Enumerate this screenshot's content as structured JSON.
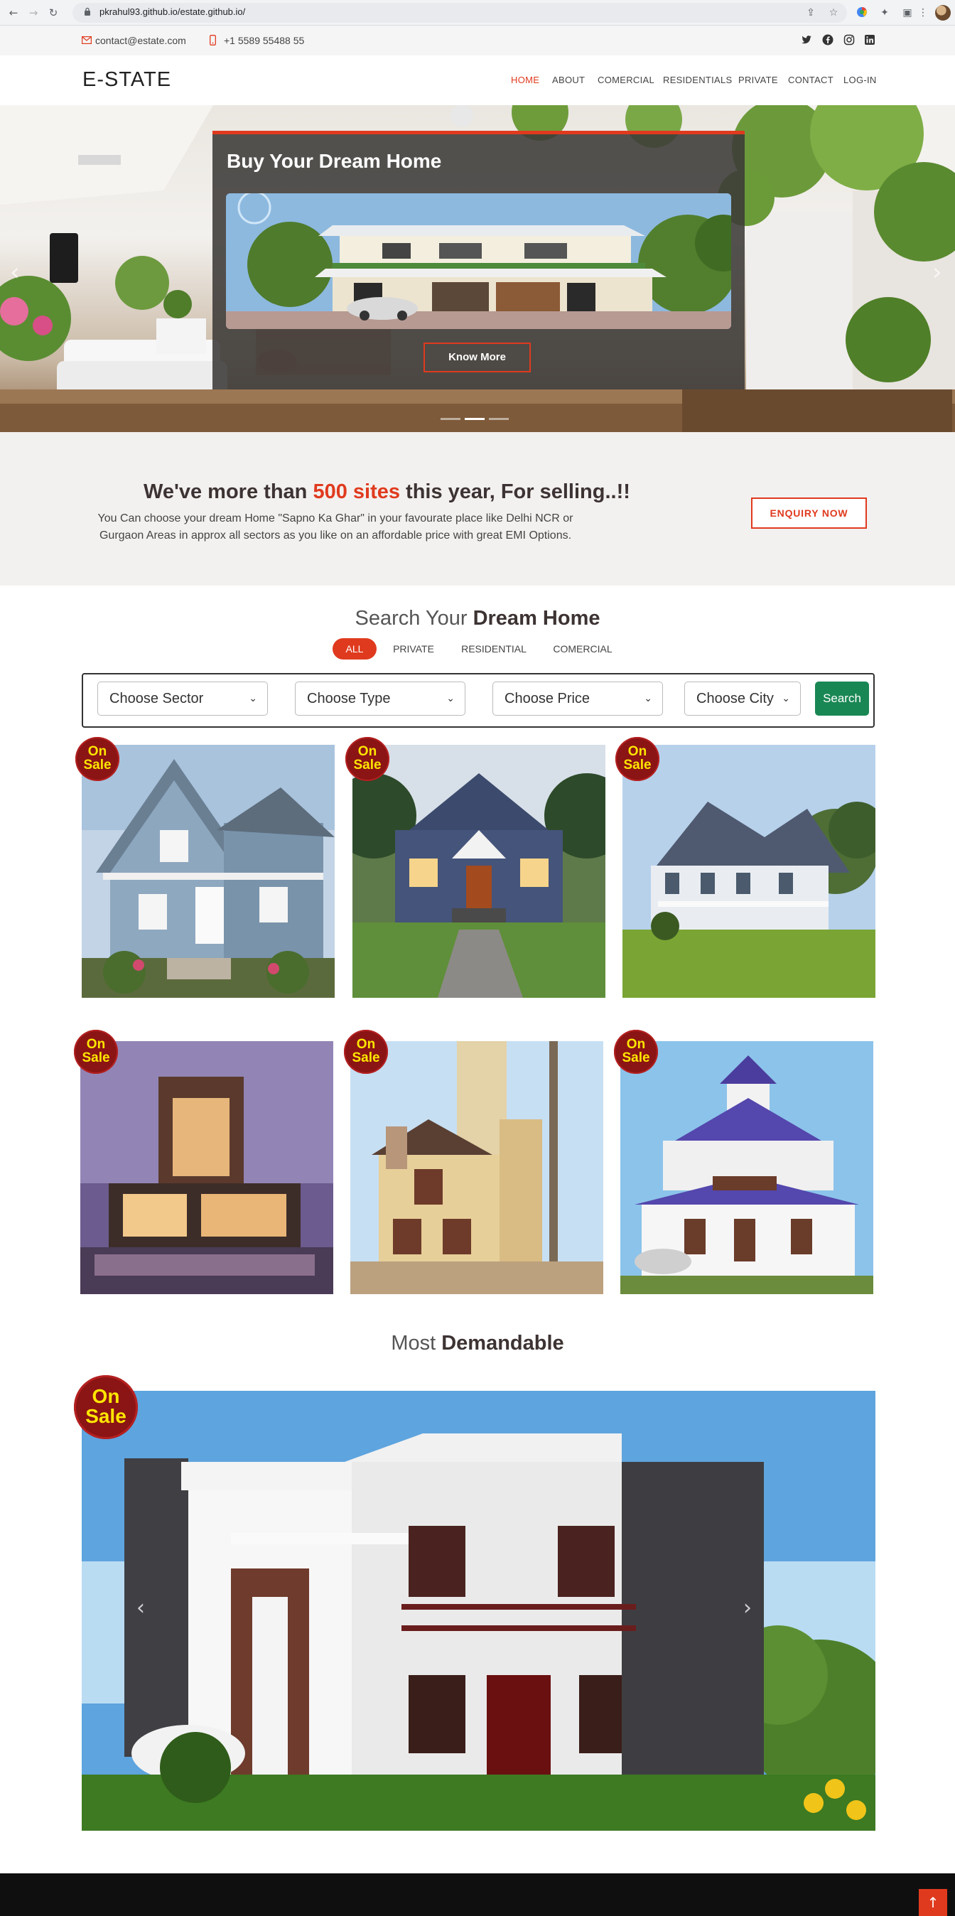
{
  "browser": {
    "url": "pkrahul93.github.io/estate.github.io/"
  },
  "topbar": {
    "email": "contact@estate.com",
    "phone": "+1 5589 55488 55",
    "email_icon": "envelope-icon",
    "phone_icon": "phone-icon",
    "socials": [
      "twitter-icon",
      "facebook-icon",
      "instagram-icon",
      "linkedin-icon"
    ]
  },
  "header": {
    "logo": "E-STATE",
    "nav": [
      {
        "label": "HOME",
        "active": true
      },
      {
        "label": "ABOUT"
      },
      {
        "label": "COMERCIAL"
      },
      {
        "label": "RESIDENTIALS"
      },
      {
        "label": "PRIVATE"
      },
      {
        "label": "CONTACT"
      },
      {
        "label": "LOG-IN"
      }
    ]
  },
  "hero": {
    "title": "Buy Your Dream Home",
    "button": "Know More",
    "slide_count": 3,
    "active_slide": 2
  },
  "cta": {
    "title_pre": "We've more than ",
    "title_accent": "500 sites",
    "title_post": " this year, For selling..!!",
    "text": "You Can choose your dream Home \"Sapno Ka Ghar\" in your favourate place like Delhi NCR or Gurgaon Areas in approx all sectors as you like on an affordable price with great EMI Options.",
    "button": "ENQUIRY NOW"
  },
  "search": {
    "title_pre": "Search Your ",
    "title_bold": "Dream Home",
    "filters": [
      {
        "label": "ALL",
        "active": true
      },
      {
        "label": "PRIVATE"
      },
      {
        "label": "RESIDENTIAL"
      },
      {
        "label": "COMERCIAL"
      }
    ],
    "selects": [
      "Choose Sector",
      "Choose Type",
      "Choose Price",
      "Choose City"
    ],
    "button": "Search"
  },
  "listings": {
    "badge_line1": "On",
    "badge_line2": "Sale",
    "count": 6
  },
  "featured": {
    "title_pre": "Most ",
    "title_bold": "Demandable",
    "badge_line1": "On",
    "badge_line2": "Sale"
  },
  "colors": {
    "accent": "#e03a1e",
    "search_button": "#198754",
    "badge": "#8b1414",
    "badge_text": "#ffe600"
  }
}
